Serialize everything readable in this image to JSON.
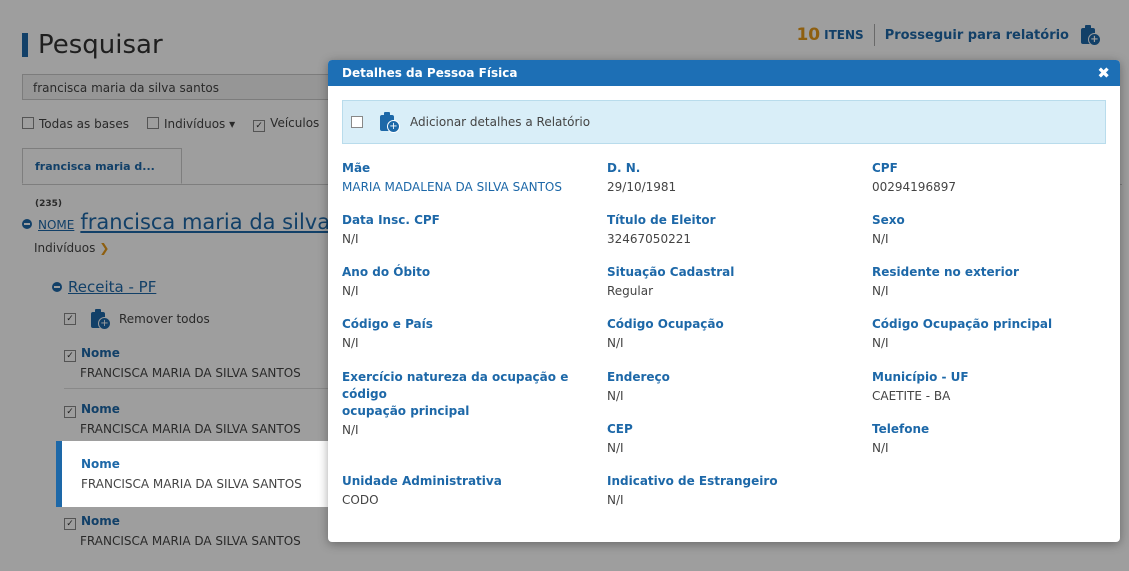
{
  "page": {
    "title": "Pesquisar",
    "count": "10",
    "count_label": "ITENS",
    "proceed_label": "Prosseguir para relatório",
    "search_value": "francisca maria da silva santos",
    "filters": [
      "Todas as bases",
      "Indivíduos",
      "Veículos"
    ],
    "tab_label": "francisca maria d...",
    "tab_count": "(235)",
    "nome_prefix": "NOME",
    "nome_value": "francisca maria da silva s",
    "individuos_label": "Indivíduos",
    "receita_label": "Receita - PF",
    "remover_label": "Remover todos",
    "records": [
      {
        "label": "Nome",
        "value": "FRANCISCA MARIA DA SILVA SANTOS"
      },
      {
        "label": "Nome",
        "value": "FRANCISCA MARIA DA SILVA SANTOS"
      },
      {
        "label": "Nome",
        "value": "FRANCISCA MARIA DA SILVA SANTOS"
      },
      {
        "label": "Nome",
        "value": "FRANCISCA MARIA DA SILVA SANTOS"
      }
    ]
  },
  "modal": {
    "title": "Detalhes da Pessoa Física",
    "close_glyph": "✖",
    "add_label": "Adicionar detalhes a Relatório",
    "fields": {
      "mae": {
        "label": "Mãe",
        "value": "MARIA MADALENA DA SILVA SANTOS"
      },
      "dn": {
        "label": "D. N.",
        "value": "29/10/1981"
      },
      "cpf": {
        "label": "CPF",
        "value": "00294196897"
      },
      "data_insc_cpf": {
        "label": "Data Insc. CPF",
        "value": "N/I"
      },
      "titulo_eleitor": {
        "label": "Título de Eleitor",
        "value": "32467050221"
      },
      "sexo": {
        "label": "Sexo",
        "value": "N/I"
      },
      "ano_obito": {
        "label": "Ano do Óbito",
        "value": "N/I"
      },
      "situacao_cadastral": {
        "label": "Situação Cadastral",
        "value": "Regular"
      },
      "residente_exterior": {
        "label": "Residente no exterior",
        "value": "N/I"
      },
      "codigo_pais": {
        "label": "Código e País",
        "value": "N/I"
      },
      "codigo_ocupacao": {
        "label": "Código Ocupação",
        "value": "N/I"
      },
      "codigo_ocupacao_principal": {
        "label": "Código Ocupação principal",
        "value": "N/I"
      },
      "exercicio": {
        "label_line1": "Exercício natureza da ocupação e código",
        "label_line2": "ocupação principal",
        "value": "N/I"
      },
      "endereco": {
        "label": "Endereço",
        "value": "N/I"
      },
      "municipio_uf": {
        "label": "Município - UF",
        "value": "CAETITE - BA"
      },
      "cep": {
        "label": "CEP",
        "value": "N/I"
      },
      "telefone": {
        "label": "Telefone",
        "value": "N/I"
      },
      "unidade_administrativa": {
        "label": "Unidade Administrativa",
        "value": "CODO"
      },
      "indicativo_estrangeiro": {
        "label": "Indicativo de Estrangeiro",
        "value": "N/I"
      }
    }
  },
  "colors": {
    "primary": "#1d68a8",
    "header": "#1d6fb5",
    "accent": "#e59a1b",
    "banner": "#d9eef8"
  },
  "icons": [
    "clipboard-add-icon",
    "close-icon",
    "chevron-down-icon",
    "collapse-circle-icon",
    "checkbox-icon"
  ]
}
